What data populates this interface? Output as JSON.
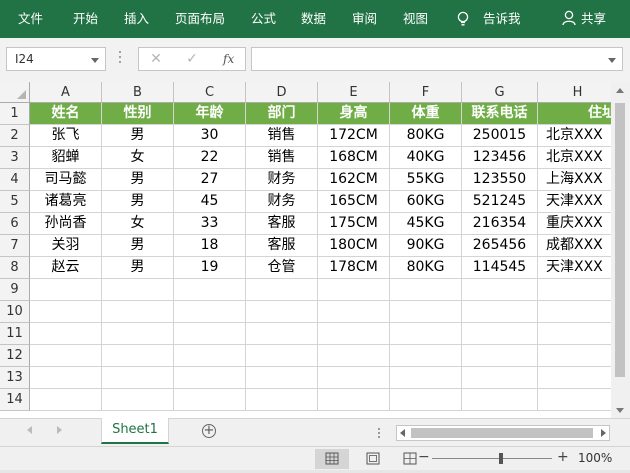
{
  "ribbon": {
    "menus": [
      "文件",
      "开始",
      "插入",
      "页面布局",
      "公式",
      "数据",
      "审阅",
      "视图"
    ],
    "tell_me": "告诉我",
    "share": "共享"
  },
  "formula_bar": {
    "name_box": "I24",
    "cancel_glyph": "✕",
    "enter_glyph": "✓",
    "fx_label": "fx",
    "formula": ""
  },
  "columns": [
    "A",
    "B",
    "C",
    "D",
    "E",
    "F",
    "G",
    "H"
  ],
  "rows": [
    "1",
    "2",
    "3",
    "4",
    "5",
    "6",
    "7",
    "8",
    "9",
    "10",
    "11",
    "12",
    "13",
    "14"
  ],
  "table": {
    "headers": [
      "姓名",
      "性别",
      "年龄",
      "部门",
      "身高",
      "体重",
      "联系电话",
      "住址"
    ],
    "records": [
      [
        "张飞",
        "男",
        "30",
        "销售",
        "172CM",
        "80KG",
        "250015",
        "北京XXX"
      ],
      [
        "貂蝉",
        "女",
        "22",
        "销售",
        "168CM",
        "40KG",
        "123456",
        "北京XXX"
      ],
      [
        "司马懿",
        "男",
        "27",
        "财务",
        "162CM",
        "55KG",
        "123550",
        "上海XXX"
      ],
      [
        "诸葛亮",
        "男",
        "45",
        "财务",
        "165CM",
        "60KG",
        "521245",
        "天津XXX"
      ],
      [
        "孙尚香",
        "女",
        "33",
        "客服",
        "175CM",
        "45KG",
        "216354",
        "重庆XXX"
      ],
      [
        "关羽",
        "男",
        "18",
        "客服",
        "180CM",
        "90KG",
        "265456",
        "成都XXX"
      ],
      [
        "赵云",
        "男",
        "19",
        "仓管",
        "178CM",
        "80KG",
        "114545",
        "天津XXX"
      ]
    ]
  },
  "sheet_tab": "Sheet1",
  "add_sheet_glyph": "+",
  "status": {
    "zoom": "100%",
    "zoom_out": "−",
    "zoom_in": "+"
  },
  "colors": {
    "ribbon": "#217346",
    "header_fill": "#70ad47",
    "header_text": "#ffffff"
  }
}
